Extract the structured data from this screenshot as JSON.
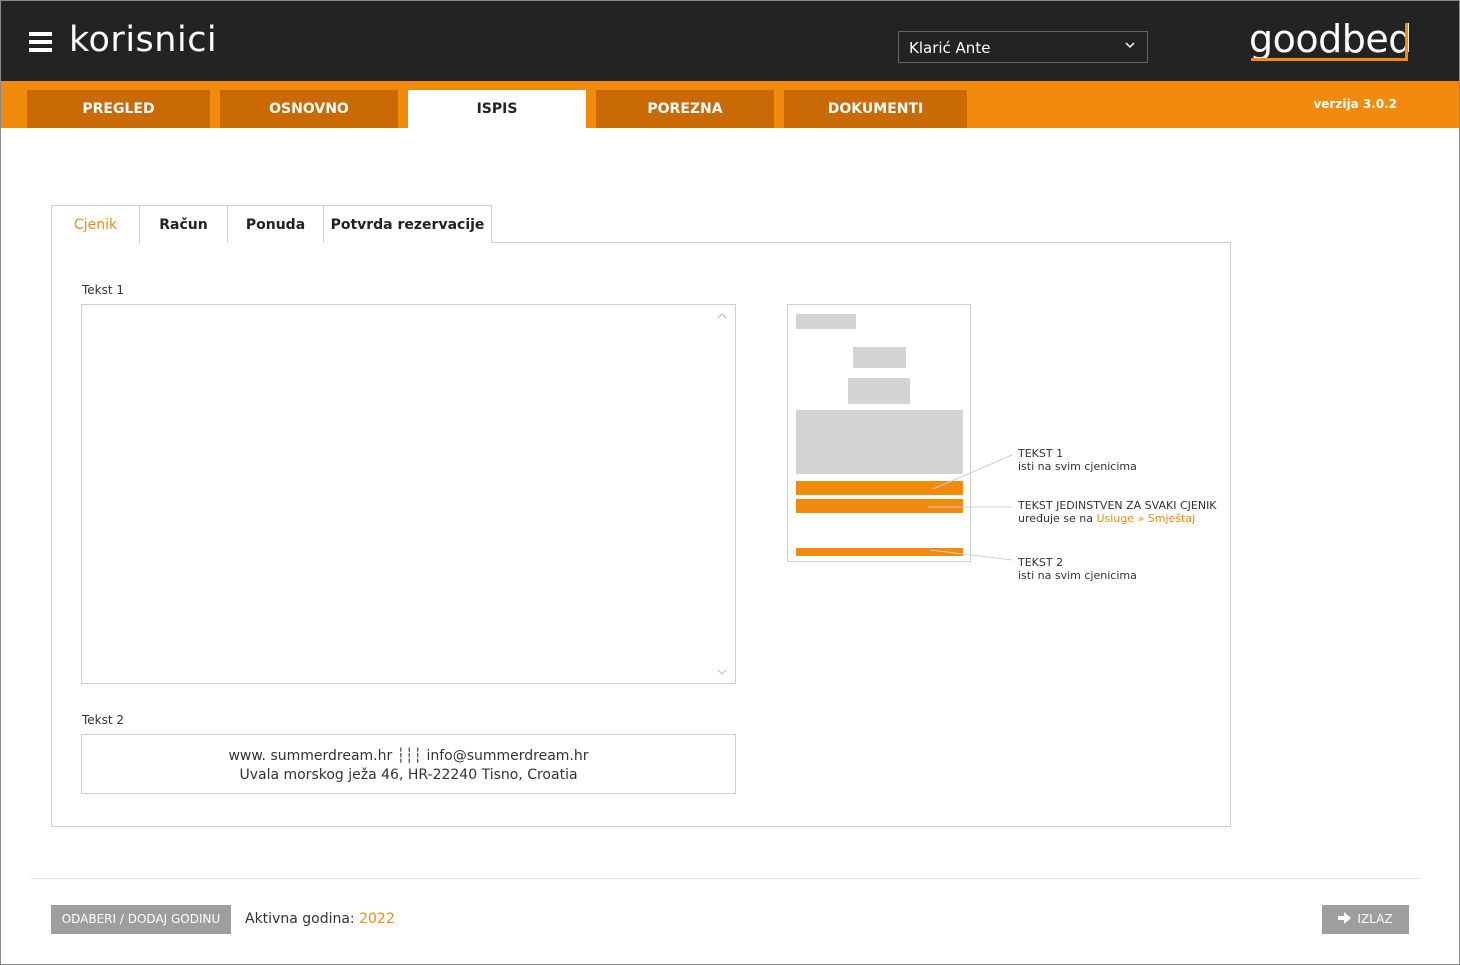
{
  "header": {
    "title": "korisnici",
    "user_select_value": "Klarić Ante",
    "logo": "goodbed",
    "version": "verzija 3.0.2"
  },
  "nav": {
    "tabs": [
      {
        "label": "PREGLED",
        "active": false
      },
      {
        "label": "OSNOVNO",
        "active": false
      },
      {
        "label": "ISPIS",
        "active": true
      },
      {
        "label": "POREZNA",
        "active": false
      },
      {
        "label": "DOKUMENTI",
        "active": false
      }
    ]
  },
  "subtabs": [
    {
      "label": "Cjenik",
      "active": true
    },
    {
      "label": "Račun",
      "active": false
    },
    {
      "label": "Ponuda",
      "active": false
    },
    {
      "label": "Potvrda rezervacije",
      "active": false
    }
  ],
  "form": {
    "tekst1_label": "Tekst 1",
    "tekst1_value": "",
    "tekst2_label": "Tekst 2",
    "tekst2_line1": "www. summerdream.hr ┆┆┆ info@summerdream.hr",
    "tekst2_line2": "Uvala morskog ježa 46, HR-22240 Tisno, Croatia"
  },
  "annotations": {
    "a1_title": "TEKST 1",
    "a1_sub": "isti na svim cjenicima",
    "a2_title": "TEKST JEDINSTVEN ZA SVAKI CJENIK",
    "a2_sub_prefix": "uređuje se na",
    "a2_link": "Usluge » Smještaj",
    "a3_title": "TEKST 2",
    "a3_sub": "isti na svim cjenicima"
  },
  "footer": {
    "year_button": "ODABERI / DODAJ GODINU",
    "active_year_label": "Aktivna godina:",
    "active_year_value": "2022",
    "exit_button": "IZLAZ"
  },
  "colors": {
    "accent": "#f28b0c",
    "header_bg": "#232323",
    "tab_bg": "#c96a05",
    "button_gray": "#9e9e9e"
  },
  "icons": [
    "menu-icon",
    "chevron-down-icon",
    "chevron-up-icon",
    "arrow-right-icon"
  ]
}
